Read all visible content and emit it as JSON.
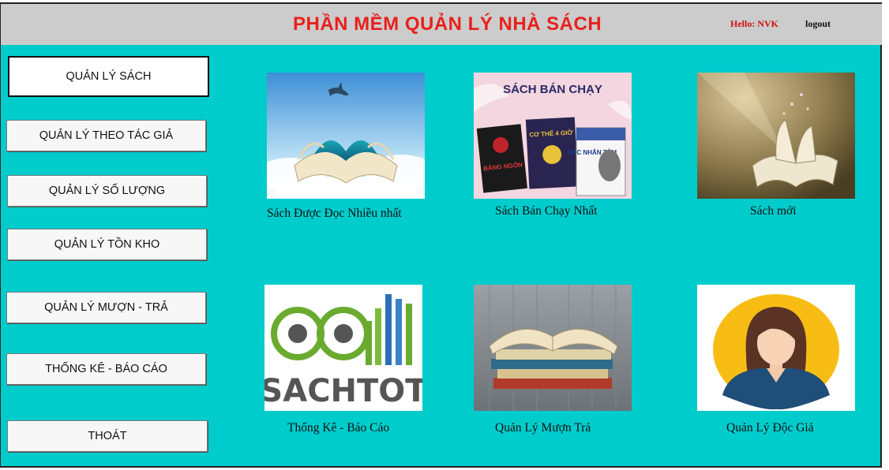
{
  "header": {
    "title": "PHẦN MỀM QUẢN LÝ NHÀ SÁCH",
    "greeting": "Hello: NVK",
    "logout_label": "logout"
  },
  "sidebar": {
    "items": [
      {
        "label": "QUẢN LÝ SÁCH"
      },
      {
        "label": "QUẢN LÝ THEO TÁC GIẢ"
      },
      {
        "label": "QUẢN LÝ SỐ LƯỢNG"
      },
      {
        "label": "QUẢN LÝ TỒN KHO"
      },
      {
        "label": "QUẢN LÝ MƯỢN - TRẢ"
      },
      {
        "label": "THỐNG KÊ - BÁO CÁO"
      },
      {
        "label": "THOÁT"
      }
    ]
  },
  "tiles": [
    {
      "caption": "Sách Được Đọc Nhiều nhất"
    },
    {
      "caption": "Sách Bán Chạy Nhất",
      "image_heading": "SÁCH BÁN CHẠY",
      "book_titles": [
        "BĂNG NGÔN",
        "CƠ THỂ 4 GIỜ",
        "ĐẮC NHÂN TÂM"
      ]
    },
    {
      "caption": "Sách mới"
    },
    {
      "caption": "Thống Kê - Báo Cáo",
      "logo_text": "SACHTOT"
    },
    {
      "caption": "Quản Lý Mượn Trả"
    },
    {
      "caption": "Quản Lý Độc Giả"
    }
  ],
  "colors": {
    "background": "#00cccc",
    "header_bg": "#cccccc",
    "title": "#e8201c",
    "greeting": "#d01010"
  }
}
